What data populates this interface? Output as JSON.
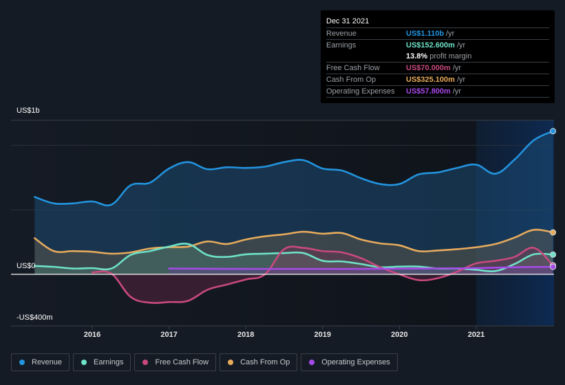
{
  "tooltip": {
    "date": "Dec 31 2021",
    "rows": [
      {
        "label": "Revenue",
        "value": "US$1.110b",
        "unit": "/yr",
        "color": "#2394df"
      },
      {
        "label": "Earnings",
        "value": "US$152.600m",
        "unit": "/yr",
        "color": "#6ee3c8"
      },
      {
        "label": "Free Cash Flow",
        "value": "US$70.000m",
        "unit": "/yr",
        "color": "#c9497f"
      },
      {
        "label": "Cash From Op",
        "value": "US$325.100m",
        "unit": "/yr",
        "color": "#e8ab5c"
      },
      {
        "label": "Operating Expenses",
        "value": "US$57.800m",
        "unit": "/yr",
        "color": "#a64ae9"
      }
    ],
    "margin_value": "13.8%",
    "margin_label": "profit margin"
  },
  "legend": [
    {
      "label": "Revenue",
      "color": "#2394df"
    },
    {
      "label": "Earnings",
      "color": "#6ee3c8"
    },
    {
      "label": "Free Cash Flow",
      "color": "#c9497f"
    },
    {
      "label": "Cash From Op",
      "color": "#e8ab5c"
    },
    {
      "label": "Operating Expenses",
      "color": "#a64ae9"
    }
  ],
  "chart_data": {
    "type": "area",
    "title": "",
    "xlabel": "",
    "ylabel": "",
    "y_tick_labels": [
      "US$1b",
      "US$0",
      "-US$400m"
    ],
    "x_tick_labels": [
      "2016",
      "2017",
      "2018",
      "2019",
      "2020",
      "2021"
    ],
    "x_ticks": [
      2016,
      2017,
      2018,
      2019,
      2020,
      2021
    ],
    "xlim": [
      2015.23,
      2022.0
    ],
    "ylim": [
      -400,
      1190
    ],
    "gridlines_m": [
      500,
      1000
    ],
    "highlight_start": 2021.0,
    "units": "US$ millions",
    "legend_position": "bottom",
    "series": [
      {
        "name": "Revenue",
        "color": "#2394df",
        "x": [
          2015.25,
          2015.5,
          2015.75,
          2016.0,
          2016.25,
          2016.5,
          2016.75,
          2017.0,
          2017.25,
          2017.5,
          2017.75,
          2018.0,
          2018.25,
          2018.5,
          2018.75,
          2019.0,
          2019.25,
          2019.5,
          2019.75,
          2020.0,
          2020.25,
          2020.5,
          2020.75,
          2021.0,
          2021.25,
          2021.5,
          2021.75,
          2022.0
        ],
        "values": [
          600,
          550,
          550,
          565,
          540,
          690,
          710,
          820,
          870,
          815,
          830,
          825,
          835,
          870,
          885,
          820,
          805,
          745,
          700,
          700,
          775,
          790,
          825,
          850,
          780,
          890,
          1040,
          1110
        ]
      },
      {
        "name": "Cash From Op",
        "color": "#e8ab5c",
        "x": [
          2015.25,
          2015.5,
          2015.75,
          2016.0,
          2016.25,
          2016.5,
          2016.75,
          2017.0,
          2017.25,
          2017.5,
          2017.75,
          2018.0,
          2018.25,
          2018.5,
          2018.75,
          2019.0,
          2019.25,
          2019.5,
          2019.75,
          2020.0,
          2020.25,
          2020.5,
          2020.75,
          2021.0,
          2021.25,
          2021.5,
          2021.75,
          2022.0
        ],
        "values": [
          280,
          180,
          180,
          175,
          160,
          170,
          200,
          210,
          215,
          255,
          235,
          270,
          295,
          310,
          330,
          315,
          320,
          270,
          240,
          225,
          180,
          185,
          195,
          210,
          235,
          285,
          345,
          325
        ]
      },
      {
        "name": "Earnings",
        "color": "#6ee3c8",
        "x": [
          2015.25,
          2015.5,
          2015.75,
          2016.0,
          2016.25,
          2016.5,
          2016.75,
          2017.0,
          2017.25,
          2017.5,
          2017.75,
          2018.0,
          2018.25,
          2018.5,
          2018.75,
          2019.0,
          2019.25,
          2019.5,
          2019.75,
          2020.0,
          2020.25,
          2020.5,
          2020.75,
          2021.0,
          2021.25,
          2021.5,
          2021.75,
          2022.0
        ],
        "values": [
          65,
          58,
          45,
          48,
          45,
          150,
          180,
          215,
          235,
          150,
          135,
          155,
          160,
          165,
          165,
          105,
          100,
          80,
          55,
          60,
          60,
          45,
          45,
          35,
          25,
          80,
          155,
          153
        ]
      },
      {
        "name": "Free Cash Flow",
        "color": "#c9497f",
        "x": [
          2016.0,
          2016.25,
          2016.5,
          2016.75,
          2017.0,
          2017.25,
          2017.5,
          2017.75,
          2018.0,
          2018.25,
          2018.5,
          2018.75,
          2019.0,
          2019.25,
          2019.5,
          2019.75,
          2020.0,
          2020.25,
          2020.5,
          2020.75,
          2021.0,
          2021.25,
          2021.5,
          2021.75,
          2022.0
        ],
        "values": [
          15,
          5,
          -175,
          -220,
          -215,
          -205,
          -120,
          -80,
          -40,
          0,
          195,
          205,
          180,
          170,
          125,
          55,
          0,
          -45,
          -30,
          20,
          85,
          105,
          135,
          205,
          70
        ]
      },
      {
        "name": "Operating Expenses",
        "color": "#a64ae9",
        "x": [
          2017.0,
          2017.5,
          2018.0,
          2018.5,
          2019.0,
          2019.5,
          2020.0,
          2020.5,
          2021.0,
          2021.5,
          2022.0
        ],
        "values": [
          45,
          43,
          42,
          42,
          42,
          42,
          44,
          46,
          48,
          55,
          58
        ]
      }
    ]
  }
}
